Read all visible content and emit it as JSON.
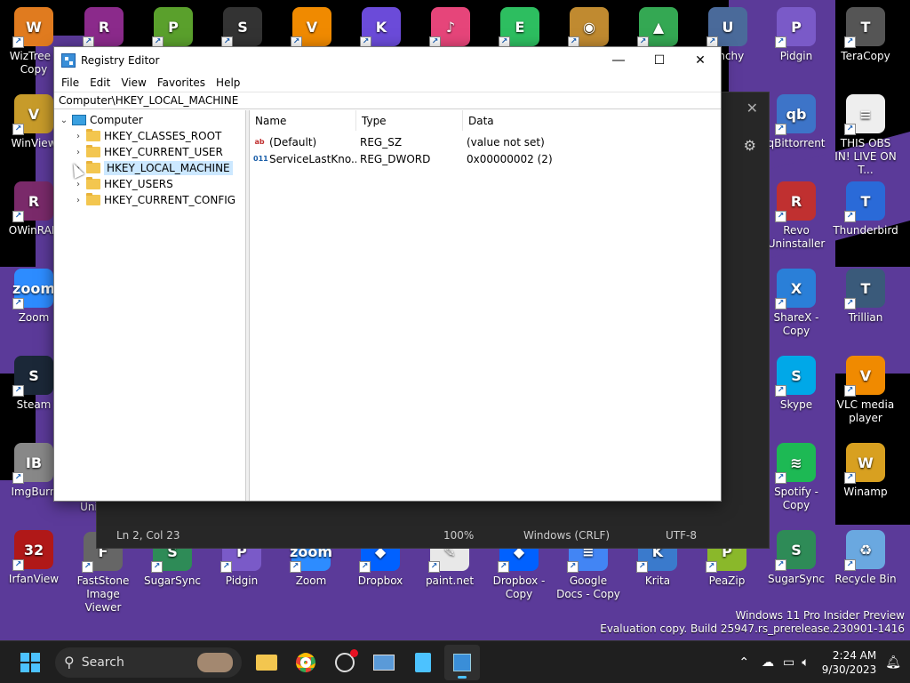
{
  "desktop": {
    "icons_left": [
      {
        "label": "WizTree - Copy",
        "color": "#e07b1f",
        "glyph": "W"
      },
      {
        "label": "WinView",
        "color": "#c79b2a",
        "glyph": "V"
      },
      {
        "label": "OWinRAR",
        "color": "#7a2a6a",
        "glyph": "R"
      },
      {
        "label": "Zoom",
        "color": "#2d8cff",
        "glyph": "zoom"
      },
      {
        "label": "Steam",
        "color": "#1b2838",
        "glyph": "S"
      },
      {
        "label": "ImgBurn",
        "color": "#888888",
        "glyph": "IB"
      },
      {
        "label": "IrfanView",
        "color": "#b01818",
        "glyph": "32"
      }
    ],
    "icons_top": [
      {
        "label": "",
        "color": "#8b2a8b",
        "glyph": "R"
      },
      {
        "label": "",
        "color": "#5aa02c",
        "glyph": "P"
      },
      {
        "label": "",
        "color": "#333333",
        "glyph": "S"
      },
      {
        "label": "",
        "color": "#f08a00",
        "glyph": "V"
      },
      {
        "label": "",
        "color": "#6b4bd9",
        "glyph": "K"
      },
      {
        "label": "",
        "color": "#e6457a",
        "glyph": "♪"
      },
      {
        "label": "",
        "color": "#2dbe60",
        "glyph": "E"
      },
      {
        "label": "",
        "color": "#c08a30",
        "glyph": "◉"
      },
      {
        "label": "",
        "color": "#34a853",
        "glyph": "▲"
      },
      {
        "label": "unchy",
        "color": "#4a6a9a",
        "glyph": "U"
      }
    ],
    "icons_right_col1": [
      {
        "label": "Pidgin",
        "color": "#7a5ac8",
        "glyph": "P"
      },
      {
        "label": "qBittorrent",
        "color": "#3d74c8",
        "glyph": "qb"
      },
      {
        "label": "Revo Uninstaller",
        "color": "#c03030",
        "glyph": "R"
      },
      {
        "label": "ShareX - Copy",
        "color": "#2a7fd8",
        "glyph": "X"
      },
      {
        "label": "Skype",
        "color": "#00a8e8",
        "glyph": "S"
      },
      {
        "label": "Spotify - Copy",
        "color": "#1db954",
        "glyph": "≋"
      },
      {
        "label": "SugarSync",
        "color": "#2e8b57",
        "glyph": "S"
      }
    ],
    "icons_right_col2": [
      {
        "label": "TeraCopy",
        "color": "#555555",
        "glyph": "T"
      },
      {
        "label": "THIS OBS IN! LIVE ON T...",
        "color": "#eeeeee",
        "glyph": "≡"
      },
      {
        "label": "Thunderbird",
        "color": "#2a6ad8",
        "glyph": "T"
      },
      {
        "label": "Trillian",
        "color": "#3a5a7a",
        "glyph": "T"
      },
      {
        "label": "VLC media player",
        "color": "#f08a00",
        "glyph": "V"
      },
      {
        "label": "Winamp",
        "color": "#d8a020",
        "glyph": "W"
      },
      {
        "label": "Recycle Bin",
        "color": "#6aa8e0",
        "glyph": "♻"
      }
    ],
    "icons_bottom": [
      {
        "label": "FastStone Image Viewer",
        "color": "#666666",
        "glyph": "F"
      },
      {
        "label": "SugarSync",
        "color": "#2e8b57",
        "glyph": "S"
      },
      {
        "label": "Pidgin",
        "color": "#7a5ac8",
        "glyph": "P"
      },
      {
        "label": "Zoom",
        "color": "#2d8cff",
        "glyph": "zoom"
      },
      {
        "label": "Dropbox",
        "color": "#0061ff",
        "glyph": "◆"
      },
      {
        "label": "paint.net",
        "color": "#e8e8e8",
        "glyph": "✎"
      },
      {
        "label": "Dropbox - Copy",
        "color": "#0061ff",
        "glyph": "◆"
      },
      {
        "label": "Google Docs - Copy",
        "color": "#4285f4",
        "glyph": "≡"
      },
      {
        "label": "Krita",
        "color": "#3a7acc",
        "glyph": "K"
      },
      {
        "label": "PeaZip",
        "color": "#8ab82a",
        "glyph": "P"
      }
    ],
    "partial_label": "Uni",
    "watermark_line1": "Windows 11 Pro Insider Preview",
    "watermark_line2": "Evaluation copy. Build 25947.rs_prerelease.230901-1416"
  },
  "notepad": {
    "status_position": "Ln 2, Col 23",
    "status_zoom": "100%",
    "status_eol": "Windows (CRLF)",
    "status_encoding": "UTF-8"
  },
  "regedit": {
    "title": "Registry Editor",
    "menu": [
      "File",
      "Edit",
      "View",
      "Favorites",
      "Help"
    ],
    "address": "Computer\\HKEY_LOCAL_MACHINE",
    "tree_root": "Computer",
    "tree_items": [
      "HKEY_CLASSES_ROOT",
      "HKEY_CURRENT_USER",
      "HKEY_LOCAL_MACHINE",
      "HKEY_USERS",
      "HKEY_CURRENT_CONFIG"
    ],
    "selected_index": 2,
    "columns": {
      "name": "Name",
      "type": "Type",
      "data": "Data"
    },
    "values": [
      {
        "name": "(Default)",
        "type": "REG_SZ",
        "data": "(value not set)",
        "icon": "ab"
      },
      {
        "name": "ServiceLastKno...",
        "type": "REG_DWORD",
        "data": "0x00000002 (2)",
        "icon": "011"
      }
    ]
  },
  "taskbar": {
    "search_label": "Search",
    "time": "2:24 AM",
    "date": "9/30/2023"
  }
}
